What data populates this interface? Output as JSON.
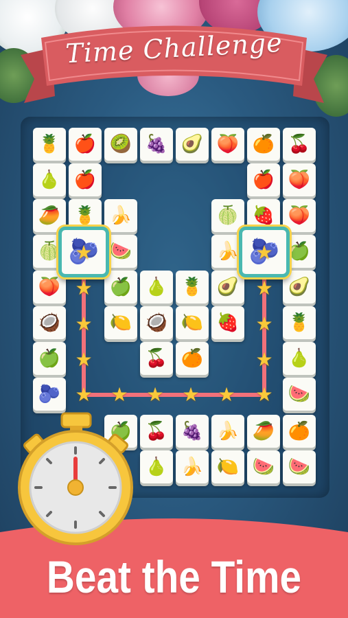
{
  "header": {
    "title": "Time Challenge"
  },
  "footer": {
    "slogan": "Beat the Time"
  },
  "colors": {
    "ribbon": "#d95c60",
    "banner": "#ee6266",
    "path": "#f2717a",
    "star": "#f9c93a",
    "selected_border": "#49b8b0"
  },
  "board": {
    "tiles": [
      {
        "icon": "🍍"
      },
      {
        "icon": "🍎"
      },
      {
        "icon": "🥝"
      },
      {
        "icon": "🍇"
      },
      {
        "icon": "🥑"
      },
      {
        "icon": "🍑"
      },
      {
        "icon": "🍊"
      },
      {
        "icon": "🍒"
      },
      {
        "icon": "🍐"
      },
      {
        "icon": "🍎"
      },
      {
        "icon": "🍎"
      },
      {
        "icon": "🍑"
      },
      {
        "icon": "🥭"
      },
      {
        "icon": "🍍"
      },
      {
        "icon": "🍌"
      },
      {
        "icon": "🍈"
      },
      {
        "icon": "🍓"
      },
      {
        "icon": "🍑"
      },
      {
        "icon": "🍈"
      },
      {
        "icon": "🍉"
      },
      {
        "icon": "🍌"
      },
      {
        "icon": "🍏"
      },
      {
        "icon": "🍑"
      },
      {
        "icon": "🍏"
      },
      {
        "icon": "🍐"
      },
      {
        "icon": "🍍"
      },
      {
        "icon": "🥑"
      },
      {
        "icon": "🥑"
      },
      {
        "icon": "🥥"
      },
      {
        "icon": "🍋"
      },
      {
        "icon": "🥥"
      },
      {
        "icon": "🍋"
      },
      {
        "icon": "🍓"
      },
      {
        "icon": "🍍"
      },
      {
        "icon": "🍏"
      },
      {
        "icon": "🍒"
      },
      {
        "icon": "🍊"
      },
      {
        "icon": "🍐"
      },
      {
        "icon": "🫐"
      },
      {
        "icon": "🍉"
      },
      {
        "icon": "🍏"
      },
      {
        "icon": "🍒"
      },
      {
        "icon": "🍇"
      },
      {
        "icon": "🍌"
      },
      {
        "icon": "🥭"
      },
      {
        "icon": "🍊"
      },
      {
        "icon": "🍐"
      },
      {
        "icon": "🍌"
      },
      {
        "icon": "🍋"
      },
      {
        "icon": "🍉"
      },
      {
        "icon": "🍉"
      }
    ],
    "selected": [
      {
        "icon": "🫐"
      },
      {
        "icon": "🫐"
      }
    ]
  },
  "stopwatch": {
    "icon": "stopwatch-icon"
  }
}
